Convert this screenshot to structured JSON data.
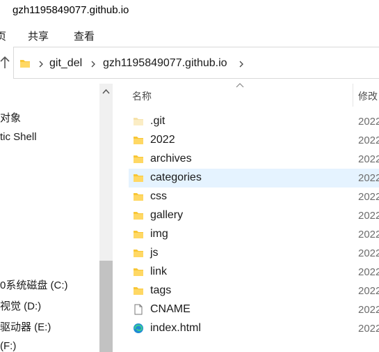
{
  "window": {
    "title": "gzh1195849077.github.io"
  },
  "ribbon": {
    "tabs": [
      "页",
      "共享",
      "查看"
    ]
  },
  "address": {
    "crumbs": [
      "git_del",
      "gzh1195849077.github.io"
    ]
  },
  "nav": {
    "items": [
      "对象",
      "tic Shell",
      "0系统磁盘 (C:)",
      "视觉 (D:)",
      "驱动器 (E:)",
      "(F:)"
    ]
  },
  "columns": {
    "name": "名称",
    "modified": "修改"
  },
  "files": [
    {
      "name": ".git",
      "date": "2022",
      "icon": "folder-faded-icon"
    },
    {
      "name": "2022",
      "date": "2022",
      "icon": "folder-icon"
    },
    {
      "name": "archives",
      "date": "2022",
      "icon": "folder-icon"
    },
    {
      "name": "categories",
      "date": "2022",
      "icon": "folder-icon",
      "selected": true
    },
    {
      "name": "css",
      "date": "2022",
      "icon": "folder-icon"
    },
    {
      "name": "gallery",
      "date": "2022",
      "icon": "folder-icon"
    },
    {
      "name": "img",
      "date": "2022",
      "icon": "folder-icon"
    },
    {
      "name": "js",
      "date": "2022",
      "icon": "folder-icon"
    },
    {
      "name": "link",
      "date": "2022",
      "icon": "folder-icon"
    },
    {
      "name": "tags",
      "date": "2022",
      "icon": "folder-icon"
    },
    {
      "name": "CNAME",
      "date": "2022",
      "icon": "file-icon"
    },
    {
      "name": "index.html",
      "date": "2022",
      "icon": "edge-html-icon"
    }
  ],
  "colors": {
    "folder": "#f8c634",
    "selected_row": "#e5f3ff",
    "scroll_thumb": "#c2c2c2"
  }
}
